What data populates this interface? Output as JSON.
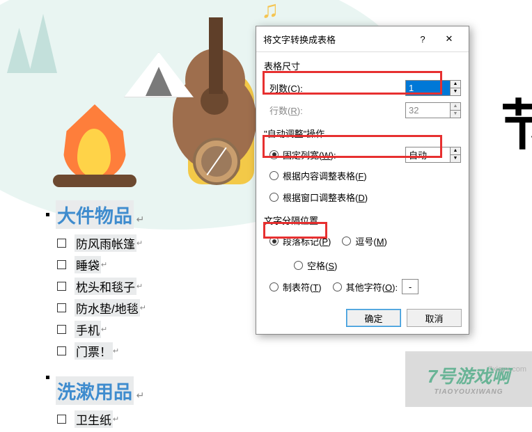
{
  "background": {
    "heading1": "大件物品",
    "heading2": "洗漱用品",
    "heading_mark": "↵",
    "big_text": "节",
    "checklist1": [
      "防风雨帐篷",
      "睡袋",
      "枕头和毯子",
      "防水垫/地毯",
      "手机",
      "门票！"
    ],
    "checklist2": [
      "卫生纸"
    ],
    "line_mark": "↵"
  },
  "dialog": {
    "title": "将文字转换成表格",
    "help": "?",
    "close": "✕",
    "table_size": {
      "label": "表格尺寸",
      "columns_label": "列数(C):",
      "columns_value": "1",
      "rows_label": "行数(R):",
      "rows_value": "32"
    },
    "autofit": {
      "label": "\"自动调整\"操作",
      "fixed_label": "固定列宽(W):",
      "fixed_value": "自动",
      "autofit_contents": "根据内容调整表格(F)",
      "autofit_window": "根据窗口调整表格(D)"
    },
    "separator": {
      "label": "文字分隔位置",
      "paragraph": "段落标记(P)",
      "comma": "逗号(M)",
      "space": "空格(S)",
      "tab": "制表符(T)",
      "other": "其他字符(O):",
      "other_value": "-"
    },
    "ok": "确定",
    "cancel": "取消"
  },
  "footer": {
    "name": "7号游戏啊",
    "sub": "TIAOYOUXIWANG",
    "url": "7xiayx.com"
  }
}
